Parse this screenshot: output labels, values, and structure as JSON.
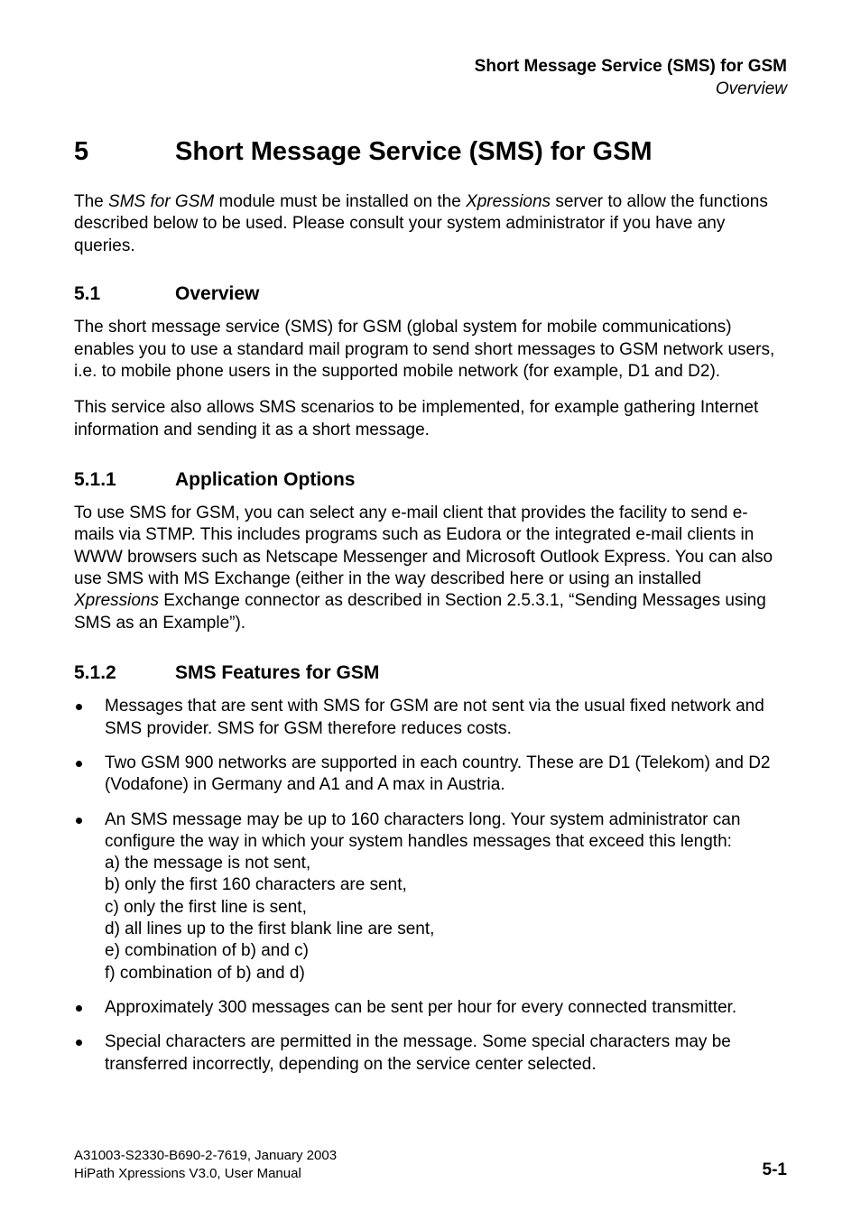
{
  "running_head": {
    "title": "Short Message Service (SMS) for GSM",
    "sub": "Overview"
  },
  "chapter": {
    "number": "5",
    "title": "Short Message Service (SMS) for GSM"
  },
  "intro_para": {
    "pre": "The ",
    "ital1": "SMS for GSM",
    "mid": " module must be installed on the ",
    "ital2": "Xpressions",
    "post": " server to allow the functions described below to be used. Please consult your system administrator if you have any queries."
  },
  "sec_5_1": {
    "number": "5.1",
    "title": "Overview",
    "p1": "The short message service (SMS) for GSM (global system for mobile communications) enables you to use a standard mail program to send short messages to GSM network users, i.e. to mobile phone users in the supported mobile network (for example, D1 and D2).",
    "p2": "This service also allows SMS scenarios to be implemented, for example gathering Internet information and sending it as a short message."
  },
  "sec_5_1_1": {
    "number": "5.1.1",
    "title": "Application Options",
    "p1_pre": "To use SMS for GSM, you can select any e-mail client that provides the facility to send e-mails via STMP. This includes programs such as Eudora or the integrated e-mail clients in WWW browsers such as Netscape Messenger and Microsoft Outlook Express. You can also use SMS with MS Exchange (either in the way described here or using an installed ",
    "p1_ital": "Xpressions",
    "p1_post": " Exchange connector as described in Section 2.5.3.1, “Sending Messages using SMS as an Example”)."
  },
  "sec_5_1_2": {
    "number": "5.1.2",
    "title": "SMS Features for GSM",
    "bullets": [
      {
        "lines": [
          "Messages that are sent with SMS for GSM are not sent via the usual fixed network and SMS provider. SMS for GSM therefore reduces costs."
        ]
      },
      {
        "lines": [
          "Two GSM 900 networks are supported in each country. These are D1 (Telekom) and D2 (Vodafone) in Germany and A1 and A max in Austria."
        ]
      },
      {
        "lines": [
          "An SMS message may be up to 160 characters long. Your system administrator can configure the way in which your system handles messages that exceed this length:",
          "a) the message is not sent,",
          "b) only the first 160 characters are sent,",
          "c) only the first line is sent,",
          "d) all lines up to the first blank line are sent,",
          "e) combination of b) and c)",
          "f) combination of b) and d)"
        ]
      },
      {
        "lines": [
          "Approximately 300 messages can be sent per hour for every connected transmitter."
        ]
      },
      {
        "lines": [
          "Special characters are permitted in the message. Some special characters may be transferred incorrectly, depending on the service center selected."
        ]
      }
    ]
  },
  "footer": {
    "line1": "A31003-S2330-B690-2-7619, January 2003",
    "line2": "HiPath Xpressions V3.0, User Manual",
    "page": "5-1"
  }
}
